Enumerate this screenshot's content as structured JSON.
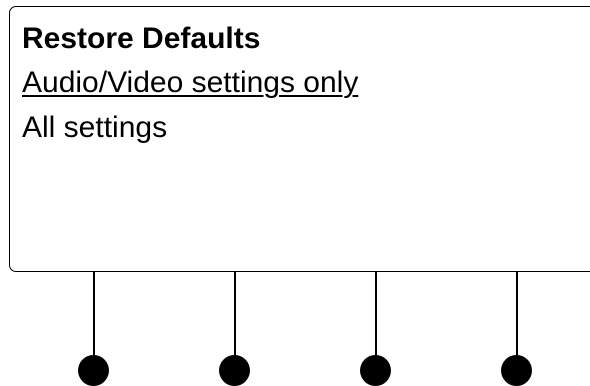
{
  "screen": {
    "title": "Restore Defaults",
    "menu_items": [
      {
        "label": "Audio/Video settings only",
        "selected": true
      },
      {
        "label": "All settings",
        "selected": false
      }
    ]
  },
  "softkeys": [
    {
      "name": "softkey-1"
    },
    {
      "name": "softkey-2"
    },
    {
      "name": "softkey-3"
    },
    {
      "name": "softkey-4"
    }
  ],
  "colors": {
    "foreground": "#000000",
    "background": "#ffffff"
  }
}
